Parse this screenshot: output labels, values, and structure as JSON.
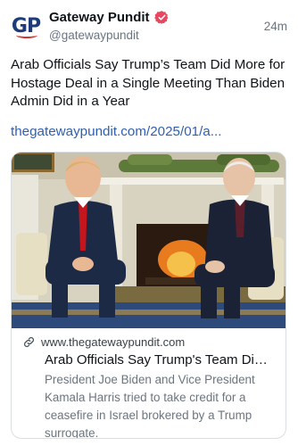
{
  "account": {
    "logo_text": "GP",
    "display_name": "Gateway Pundit",
    "handle": "@gatewaypundit",
    "verified_icon": "verified-badge-icon",
    "timestamp": "24m"
  },
  "post": {
    "text": "Arab Officials Say Trump’s Team Did More for Hostage Deal in a Single Meeting Than Biden Admin Did in a Year",
    "link_text": "thegatewaypundit.com/2025/01/a..."
  },
  "card": {
    "link_icon": "link-icon",
    "domain": "www.thegatewaypundit.com",
    "title": "Arab Officials Say Trump's Team Did ...",
    "description": "President Joe Biden and Vice President Kamala Harris tried to take credit for a ceasefire in Israel brokered by a Trump surrogate."
  },
  "colors": {
    "link": "#2f5fb3",
    "verified": "#e8475f",
    "logo_blue": "#1f3c7a",
    "logo_red": "#d9342b"
  }
}
